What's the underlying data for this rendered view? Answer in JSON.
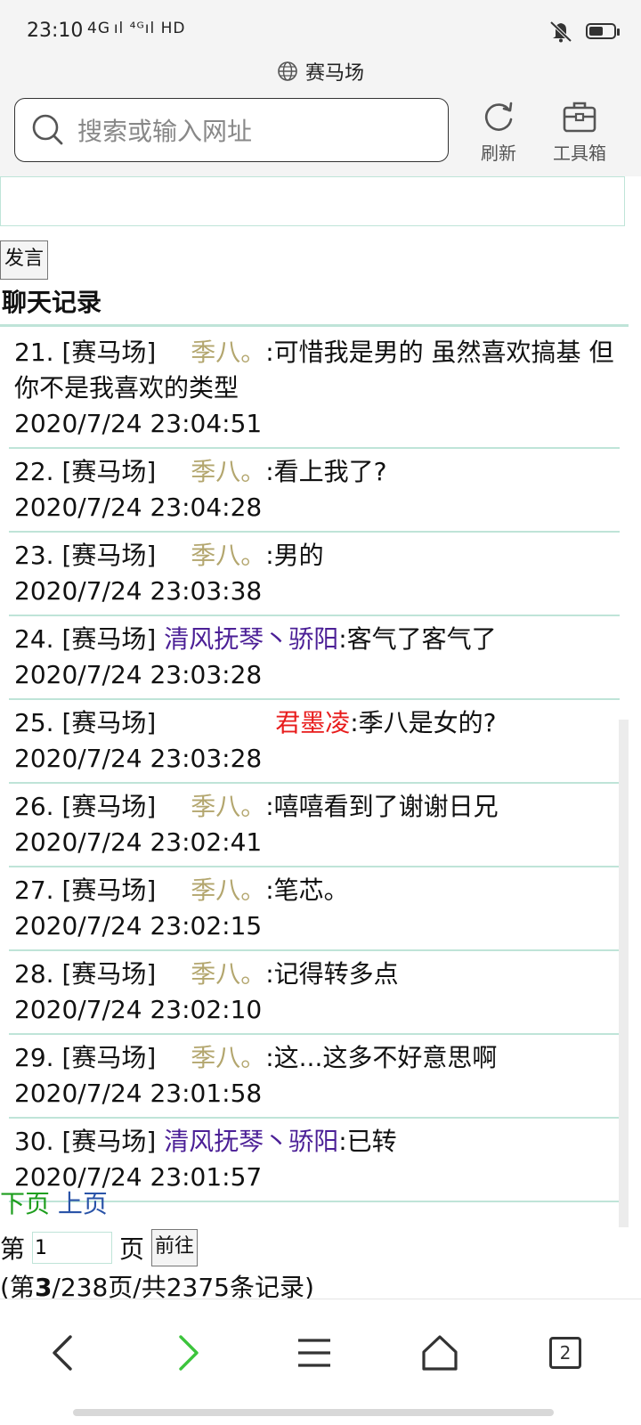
{
  "status_bar": {
    "time": "23:10",
    "signal": "4G ıl ⁴ᴳıl HD",
    "battery_level": 0.55
  },
  "browser": {
    "tab_title": "赛马场",
    "search_placeholder": "搜索或输入网址",
    "refresh_label": "刷新",
    "toolbox_label": "工具箱"
  },
  "form": {
    "speak_button": "发言",
    "section_title": "聊天记录"
  },
  "chat": {
    "messages": [
      {
        "index": "21.",
        "room": "[赛马场]",
        "nick": "季八。",
        "text": ":可惜我是男的 虽然喜欢搞基 但你不是我喜欢的类型",
        "time": "2020/7/24 23:04:51"
      },
      {
        "index": "22.",
        "room": "[赛马场]",
        "nick": "季八。",
        "text": ":看上我了?",
        "time": "2020/7/24 23:04:28"
      },
      {
        "index": "23.",
        "room": "[赛马场]",
        "nick": "季八。",
        "text": ":男的",
        "time": "2020/7/24 23:03:38"
      },
      {
        "index": "24.",
        "room": "[赛马场]",
        "nick": "清风抚琴丶骄阳",
        "text": ":客气了客气了",
        "time": "2020/7/24 23:03:28"
      },
      {
        "index": "25.",
        "room": "[赛马场]",
        "nick": "君墨凌",
        "text": ":季八是女的?",
        "time": "2020/7/24 23:03:28"
      },
      {
        "index": "26.",
        "room": "[赛马场]",
        "nick": "季八。",
        "text": ":嘻嘻看到了谢谢日兄",
        "time": "2020/7/24 23:02:41"
      },
      {
        "index": "27.",
        "room": "[赛马场]",
        "nick": "季八。",
        "text": ":笔芯。",
        "time": "2020/7/24 23:02:15"
      },
      {
        "index": "28.",
        "room": "[赛马场]",
        "nick": "季八。",
        "text": ":记得转多点",
        "time": "2020/7/24 23:02:10"
      },
      {
        "index": "29.",
        "room": "[赛马场]",
        "nick": "季八。",
        "text": ":这...这多不好意思啊",
        "time": "2020/7/24 23:01:58"
      },
      {
        "index": "30.",
        "room": "[赛马场]",
        "nick": "清风抚琴丶骄阳",
        "text": ":已转",
        "time": "2020/7/24 23:01:57"
      }
    ]
  },
  "pager": {
    "next_label": "下页",
    "prev_label": "上页",
    "page_prefix": "第",
    "page_value": "1",
    "page_suffix": "页",
    "goto_button": "前往",
    "summary_open": "(第",
    "current_page": "3",
    "summary_rest": "/238页/共2375条记录)"
  },
  "bottom_nav": {
    "tab_count": "2"
  },
  "colors": {
    "nick_ji": "#b3a66e",
    "nick_qf": "#4b1f96",
    "nick_jm": "#e81b1b",
    "next_link": "#1e9e1e",
    "prev_link": "#2a54a8",
    "rule": "#bfe4d8"
  }
}
